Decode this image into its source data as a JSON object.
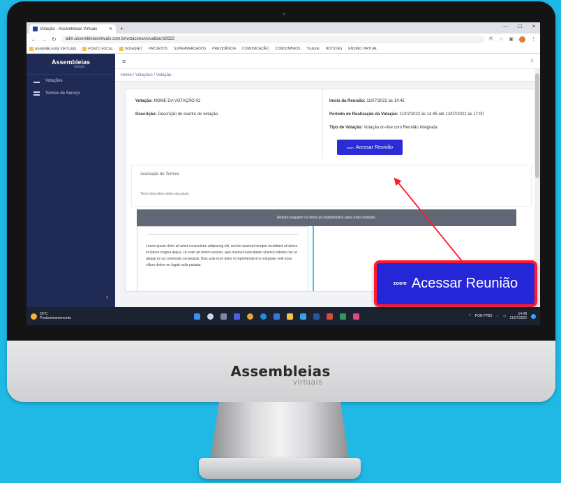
{
  "browser": {
    "tab_title": "Votação - Assembleias Virtuais",
    "new_tab": "+",
    "url": "adm.assembleiasvirtuais.com.br/votacoes/visualizar/19322",
    "bookmarks": [
      "ASSEMBLEIAS VIRTUAIS",
      "PONTO FOCAL",
      "INTRANET",
      "PROJETOS",
      "SUPERMERCADOS",
      "PREVIDÊNCIA",
      "COMUNICAÇÃO",
      "CONDOMÍNIOS",
      "Youtube",
      "NOTÍCIAS",
      "ENSINO VIRTUAL"
    ]
  },
  "app": {
    "logo": "Assembleias",
    "logo_sub": "virtuais",
    "sidebar": [
      {
        "label": "Votações"
      },
      {
        "label": "Termos de Serviço"
      }
    ],
    "collapse": "‹",
    "topbar_menu": "≡",
    "topbar_right": "3",
    "breadcrumb": "Home / Votações / Votação",
    "voting": {
      "title_label": "Votação:",
      "title_value": "NOME DA VOTAÇÃO 02",
      "description_label": "Descrição:",
      "description_value": "Descrição do evento de votação.",
      "start_label": "Início da Reunião:",
      "start_value": "11/07/2022 às 14:45",
      "period_label": "Período de Realização da Votação:",
      "period_value": "11/07/2022 às 14:45 até 12/07/2022 às 17:00",
      "type_label": "Tipo de Votação:",
      "type_value": "Votação on-line com Reunião Integrada"
    },
    "meeting_button": {
      "zoom": "zoom",
      "label": "Acessar Reunião"
    },
    "terms": {
      "title": "Aceitação de Termos",
      "text": "Texto descritivo antes da pauta."
    },
    "gray_band": "Abaixo seguem os itens já cadastrados para esta votação.",
    "body_text": "Lorem ipsum dolor sit amet consectetur adipiscing elit, sed do eiusmod tempor incididunt ut labore et dolore magna aliqua. Ut enim ad minim veniam, quis nostrud exercitation ullamco laboris nisi ut aliquip ex ea commodo consequat. Duis aute irure dolor in reprehenderit in voluptate velit esse cillum dolore eu fugiat nulla pariatur."
  },
  "taskbar": {
    "weather_temp": "25°C",
    "weather_desc": "Predominantemente",
    "tray_lang": "POR PTB2",
    "time": "14:48",
    "date": "11/07/2022"
  },
  "callout": {
    "zoom": "zoom",
    "label": "Acessar Reunião"
  },
  "brand": {
    "name": "Assembleias",
    "sub": "virtuais"
  },
  "colors": {
    "background": "#20b9e6",
    "sidebar": "#1f2b55",
    "button": "#2626d9",
    "callout_border": "#ff1a2b"
  }
}
